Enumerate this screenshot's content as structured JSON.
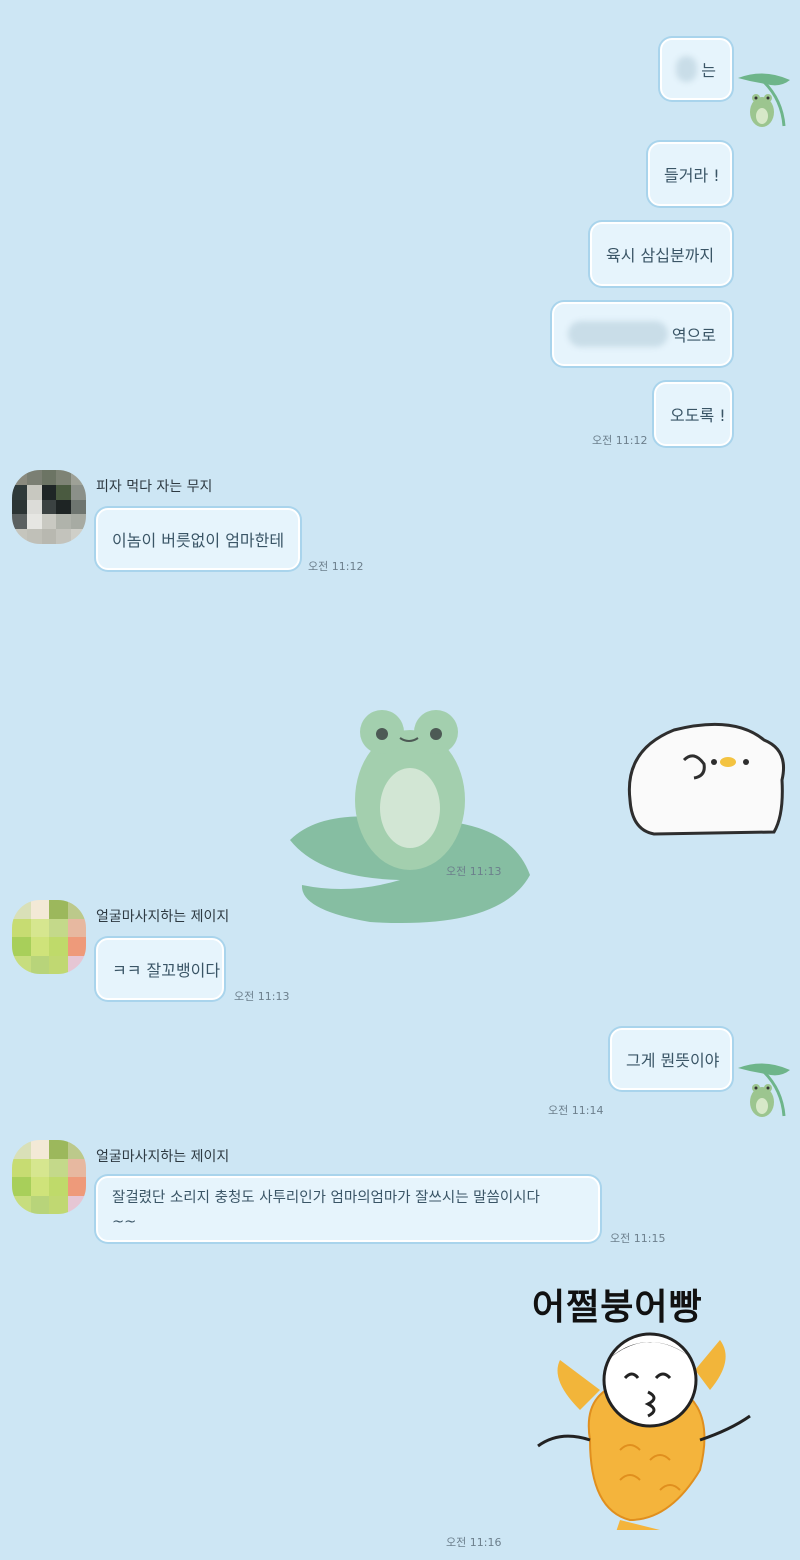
{
  "messages_out": [
    {
      "text": "는",
      "redacted_prefix": true
    },
    {
      "text": "들거라 !"
    },
    {
      "text": "육시 삼십분까지"
    },
    {
      "text": "역으로",
      "redacted_prefix": true
    },
    {
      "text": "오도록 !"
    }
  ],
  "time_1": "오전 11:12",
  "sender_1": {
    "name": "피자 먹다 자는 무지",
    "message": "이놈이 버릇없이 엄마한테",
    "time": "오전 11:12"
  },
  "sticker_frog_time": "오전 11:13",
  "sender_2": {
    "name": "얼굴마사지하는 제이지",
    "message": "ㅋㅋ 잘꼬뱅이다",
    "time": "오전 11:13"
  },
  "out_2": {
    "text": "그게 뭔뜻이야",
    "time": "오전 11:14"
  },
  "sender_3": {
    "name": "얼굴마사지하는 제이지",
    "message_line1": "잘걸렸단 소리지 충청도 사투리인가 엄마의엄마가 잘쓰시는 말씀이시다",
    "message_line2": "~~",
    "time": "오전 11:15"
  },
  "sticker_taiyaki": {
    "caption": "어쩔붕어빵",
    "time": "오전 11:16"
  },
  "colors": {
    "background": "#cde6f4",
    "bubble": "#e6f4fc",
    "bubble_border": "#a9d4ec"
  }
}
